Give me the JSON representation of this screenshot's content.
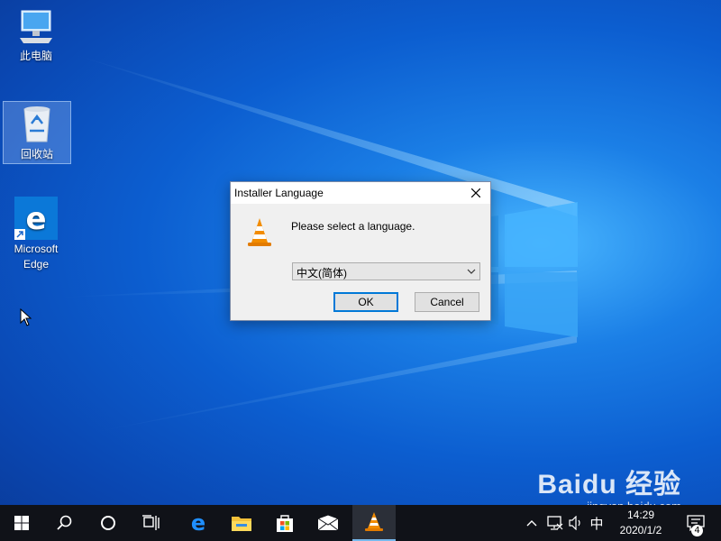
{
  "desktop": {
    "icons": [
      {
        "label": "此电脑",
        "icon": "computer-icon"
      },
      {
        "label": "回收站",
        "icon": "recycle-bin-icon"
      },
      {
        "label": "Microsoft Edge",
        "icon": "edge-icon"
      }
    ]
  },
  "dialog": {
    "title": "Installer Language",
    "prompt": "Please select a language.",
    "language_selected": "中文(简体)",
    "ok_label": "OK",
    "cancel_label": "Cancel"
  },
  "taskbar": {
    "buttons": [
      "start-icon",
      "search-icon",
      "cortana-icon",
      "task-view-icon",
      "edge-icon",
      "file-explorer-icon",
      "store-icon",
      "mail-icon",
      "vlc-icon"
    ],
    "ime_label": "中",
    "time": "14:29",
    "date": "2020/1/2",
    "notification_count": "4"
  },
  "watermark": {
    "brand": "Baidu 经验",
    "url": "jingyan.baidu.com"
  },
  "colors": {
    "accent": "#0078d7",
    "taskbar": "#101218",
    "vlc_orange": "#f28c00"
  }
}
